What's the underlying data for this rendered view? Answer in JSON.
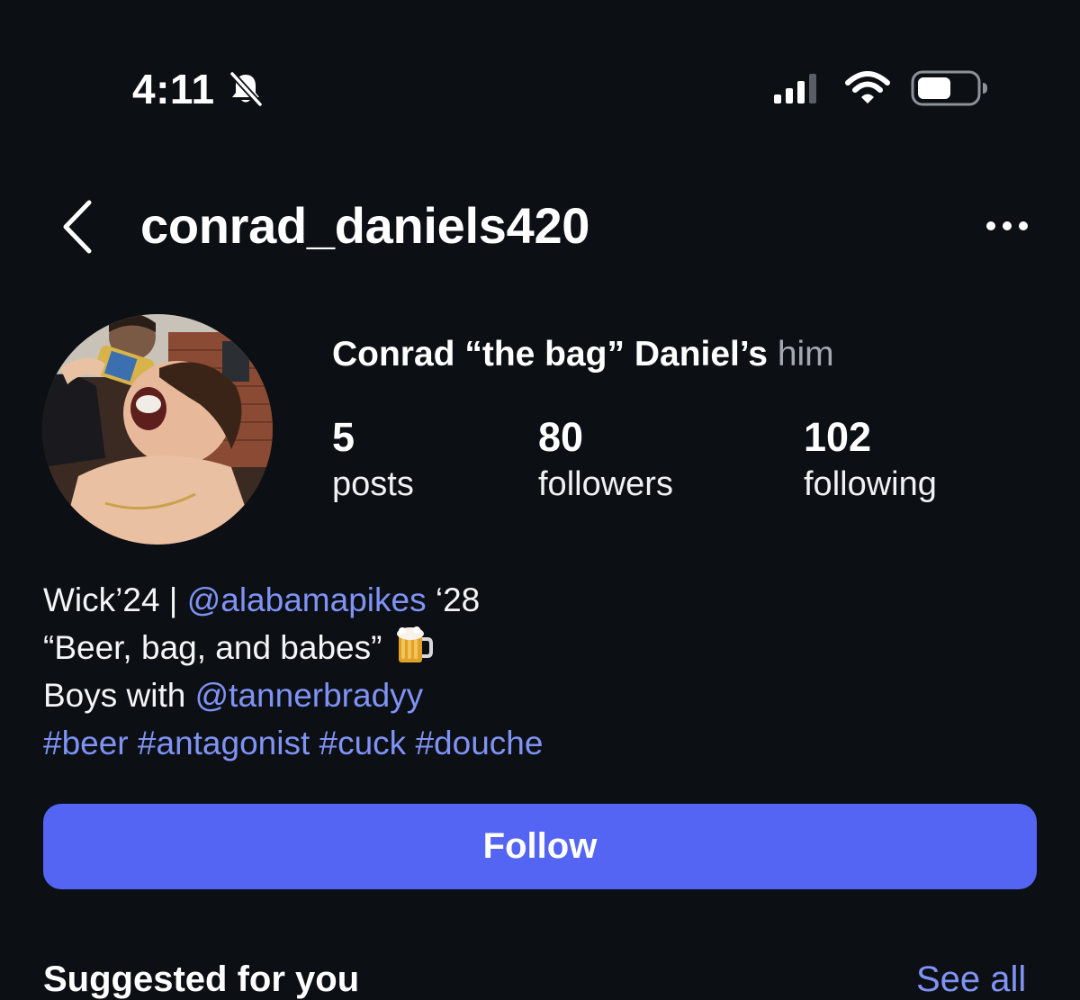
{
  "status_bar": {
    "time": "4:11",
    "icons": [
      "bell-slash-icon",
      "cellular-signal-icon",
      "wifi-icon",
      "battery-icon"
    ]
  },
  "header": {
    "back_icon": "chevron-left-icon",
    "username": "conrad_daniels420",
    "more_icon": "ellipsis-icon"
  },
  "profile": {
    "display_name": "Conrad “the bag” Daniel’s",
    "pronouns": "him",
    "stats": {
      "posts": {
        "value": "5",
        "label": "posts"
      },
      "followers": {
        "value": "80",
        "label": "followers"
      },
      "following": {
        "value": "102",
        "label": "following"
      }
    },
    "bio": {
      "line1_prefix": "Wick’24 | ",
      "line1_mention": "@alabamapikes",
      "line1_suffix": " ‘28",
      "line2_text": "“Beer, bag, and babes” ",
      "line2_emoji": "beer-mug-icon",
      "line3_prefix": "Boys with ",
      "line3_mention": "@tannerbradyy",
      "hashtags": [
        "#beer",
        "#antagonist",
        "#cuck",
        "#douche"
      ]
    },
    "follow_button_label": "Follow"
  },
  "suggested": {
    "title": "Suggested for you",
    "see_all_label": "See all"
  },
  "colors": {
    "background": "#0c0f14",
    "accent_button": "#5365f2",
    "link": "#7f93f5",
    "secondary_text": "#a3a7b0"
  }
}
